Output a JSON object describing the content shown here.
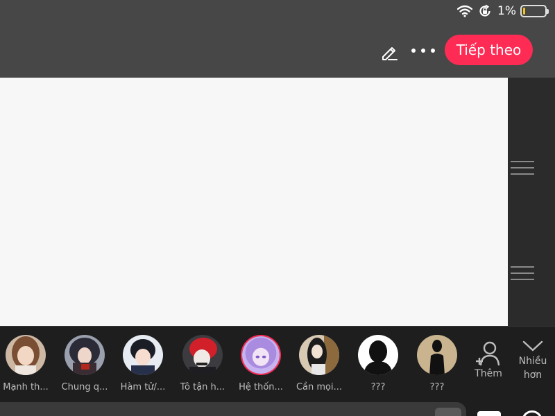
{
  "status_bar": {
    "battery_percent": "1%",
    "battery_level": 0.01,
    "icons": [
      "wifi-icon",
      "rotation-lock-icon",
      "battery-icon"
    ],
    "colors": {
      "battery_low": "#f5c518"
    }
  },
  "header": {
    "next_button_label": "Tiếp theo",
    "icons": [
      "edit-pencil-icon",
      "more-options-icon"
    ],
    "colors": {
      "accent": "#fe2c55"
    }
  },
  "characters": [
    {
      "name": "Mạnh th...",
      "avatar": "brown-hair-woman-avatar"
    },
    {
      "name": "Chung q...",
      "avatar": "dark-hair-woman-avatar"
    },
    {
      "name": "Hàm tử/...",
      "avatar": "black-hair-boy-avatar"
    },
    {
      "name": "Tô tận h...",
      "avatar": "red-hair-avatar"
    },
    {
      "name": "Hệ thốn...",
      "avatar": "purple-hair-avatar"
    },
    {
      "name": "Cần mọi...",
      "avatar": "black-hair-girl-avatar"
    },
    {
      "name": "???",
      "avatar": "silhouette-avatar"
    },
    {
      "name": "???",
      "avatar": "silhouette-avatar"
    }
  ],
  "add_button_label": "Thêm",
  "more_button_label": "Nhiều\nhơn"
}
